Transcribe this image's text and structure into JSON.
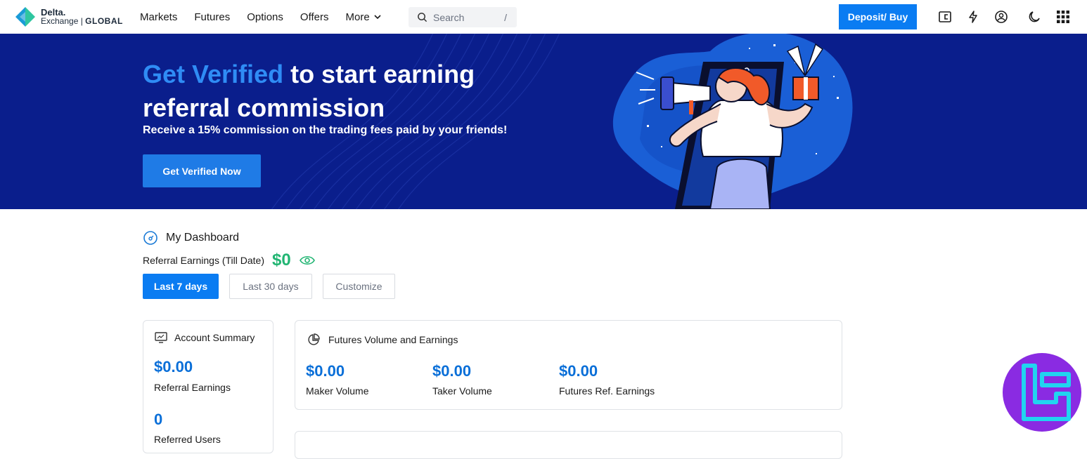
{
  "header": {
    "logo_line1": "Delta.",
    "logo_line2a": "Exchange",
    "logo_line2b": "GLOBAL",
    "nav": [
      "Markets",
      "Futures",
      "Options",
      "Offers",
      "More"
    ],
    "search_placeholder": "Search",
    "search_shortcut": "/",
    "deposit_label": "Deposit/ Buy",
    "icons": [
      "wallet-icon",
      "rewards-icon",
      "account-icon",
      "dark-mode-icon",
      "apps-grid-icon"
    ]
  },
  "banner": {
    "title_accent": "Get Verified",
    "title_rest": " to start earning referral commission",
    "subtitle": "Receive a 15% commission on the trading fees paid by your friends!",
    "cta": "Get Verified Now"
  },
  "dashboard": {
    "title": "My Dashboard",
    "earnings_label": "Referral Earnings (Till Date)",
    "earnings_value": "$0",
    "ranges": [
      "Last 7 days",
      "Last 30 days",
      "Customize"
    ],
    "active_range": "Last 7 days"
  },
  "account_summary": {
    "title": "Account Summary",
    "referral_earnings_value": "$0.00",
    "referral_earnings_label": "Referral Earnings",
    "referred_users_value": "0",
    "referred_users_label": "Referred Users"
  },
  "futures": {
    "title": "Futures Volume and Earnings",
    "items": [
      {
        "value": "$0.00",
        "label": "Maker Volume"
      },
      {
        "value": "$0.00",
        "label": "Taker Volume"
      },
      {
        "value": "$0.00",
        "label": "Futures Ref. Earnings"
      }
    ]
  },
  "colors": {
    "brand_blue": "#0a7cf2",
    "banner_bg": "#0a1e8c",
    "earnings_green": "#22b573",
    "value_blue": "#0a6fd8"
  }
}
